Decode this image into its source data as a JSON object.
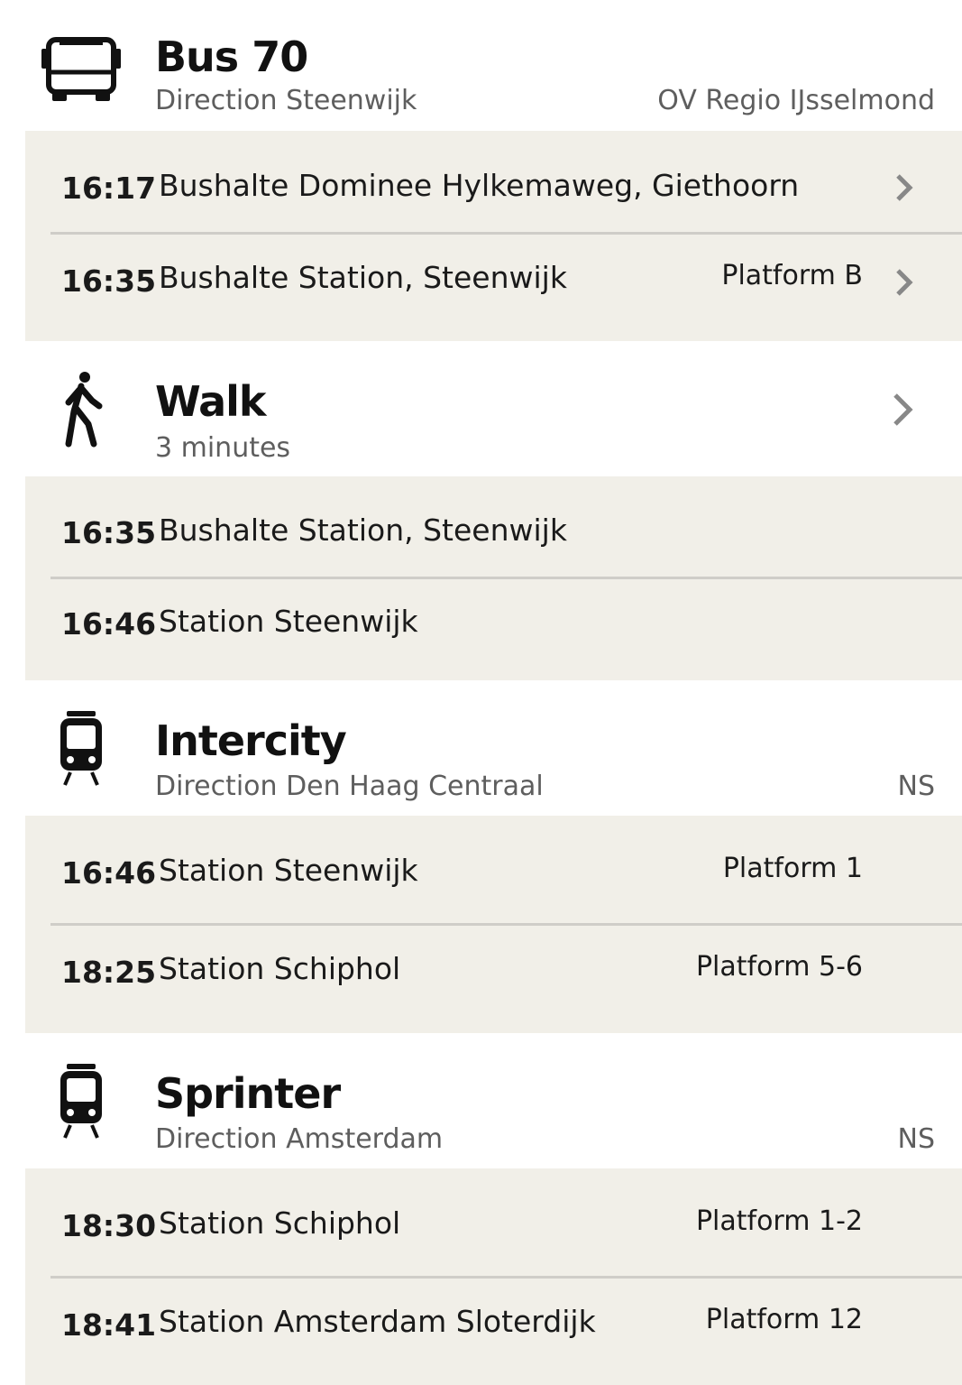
{
  "legs": [
    {
      "mode_icon": "bus-icon",
      "title": "Bus 70",
      "subtitle": "Direction Steenwijk",
      "operator": "OV Regio IJsselmond",
      "stops": [
        {
          "time": "16:17",
          "name": "Bushalte Dominee Hylkemaweg, Giethoorn",
          "platform": ""
        },
        {
          "time": "16:35",
          "name": "Bushalte Station, Steenwijk",
          "platform": "Platform B"
        }
      ]
    },
    {
      "mode_icon": "walk-icon",
      "title": "Walk",
      "subtitle": "3 minutes",
      "operator": "",
      "stops": [
        {
          "time": "16:35",
          "name": "Bushalte Station, Steenwijk",
          "platform": ""
        },
        {
          "time": "16:46",
          "name": "Station Steenwijk",
          "platform": ""
        }
      ]
    },
    {
      "mode_icon": "train-icon",
      "title": "Intercity",
      "subtitle": "Direction Den Haag Centraal",
      "operator": "NS",
      "stops": [
        {
          "time": "16:46",
          "name": "Station Steenwijk",
          "platform": "Platform 1"
        },
        {
          "time": "18:25",
          "name": "Station Schiphol",
          "platform": "Platform 5-6"
        }
      ]
    },
    {
      "mode_icon": "train-icon",
      "title": "Sprinter",
      "subtitle": "Direction Amsterdam",
      "operator": "NS",
      "stops": [
        {
          "time": "18:30",
          "name": "Station Schiphol",
          "platform": "Platform 1-2"
        },
        {
          "time": "18:41",
          "name": "Station Amsterdam Sloterdijk",
          "platform": "Platform 12"
        }
      ]
    }
  ]
}
